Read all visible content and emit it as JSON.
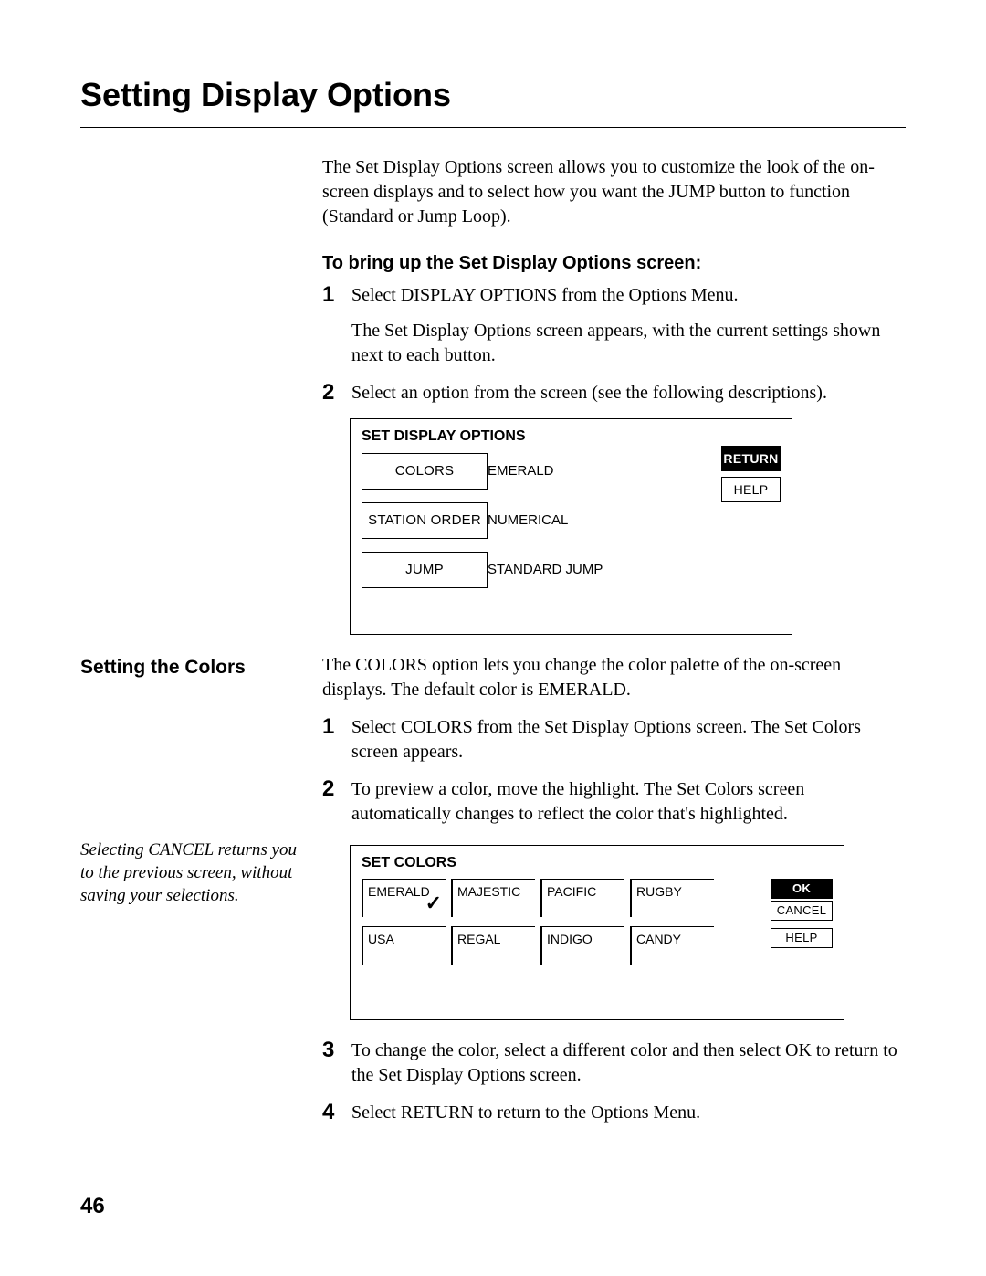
{
  "page": {
    "title": "Setting Display Options",
    "number": "46"
  },
  "intro": "The Set Display Options screen allows you to customize the look of the on-screen displays and to select how you want the JUMP button to function (Standard or Jump Loop).",
  "how_to_heading": "To bring up the Set Display Options screen:",
  "steps1": {
    "s1": "Select DISPLAY OPTIONS from the Options Menu.",
    "s1_sub": "The Set Display Options screen appears, with the current settings shown next to each button.",
    "s2": "Select an option from the screen (see the following descriptions)."
  },
  "panel1": {
    "title": "SET DISPLAY OPTIONS",
    "rows": [
      {
        "label": "COLORS",
        "value": "EMERALD"
      },
      {
        "label": "STATION ORDER",
        "value": "NUMERICAL"
      },
      {
        "label": "JUMP",
        "value": "STANDARD JUMP"
      }
    ],
    "return_btn": "RETURN",
    "help_btn": "HELP"
  },
  "section2": {
    "heading": "Setting the Colors",
    "para": "The COLORS option lets you change the color palette of the on-screen displays. The default color is EMERALD.",
    "steps": {
      "s1": "Select COLORS from the Set Display Options screen. The Set Colors screen appears.",
      "s2": "To preview a color, move the highlight. The Set Colors screen automatically changes to reflect the color that's highlighted.",
      "s3": "To change the color, select a different color and then select OK to return to the Set Display Options screen.",
      "s4": "Select RETURN to return to the Options Menu."
    },
    "margin_note": "Selecting CANCEL returns you to the previous screen, without saving your selections."
  },
  "panel2": {
    "title": "SET COLORS",
    "colors": [
      "EMERALD",
      "MAJESTIC",
      "PACIFIC",
      "RUGBY",
      "USA",
      "REGAL",
      "INDIGO",
      "CANDY"
    ],
    "selected_index": 0,
    "ok_btn": "OK",
    "cancel_btn": "CANCEL",
    "help_btn": "HELP"
  }
}
